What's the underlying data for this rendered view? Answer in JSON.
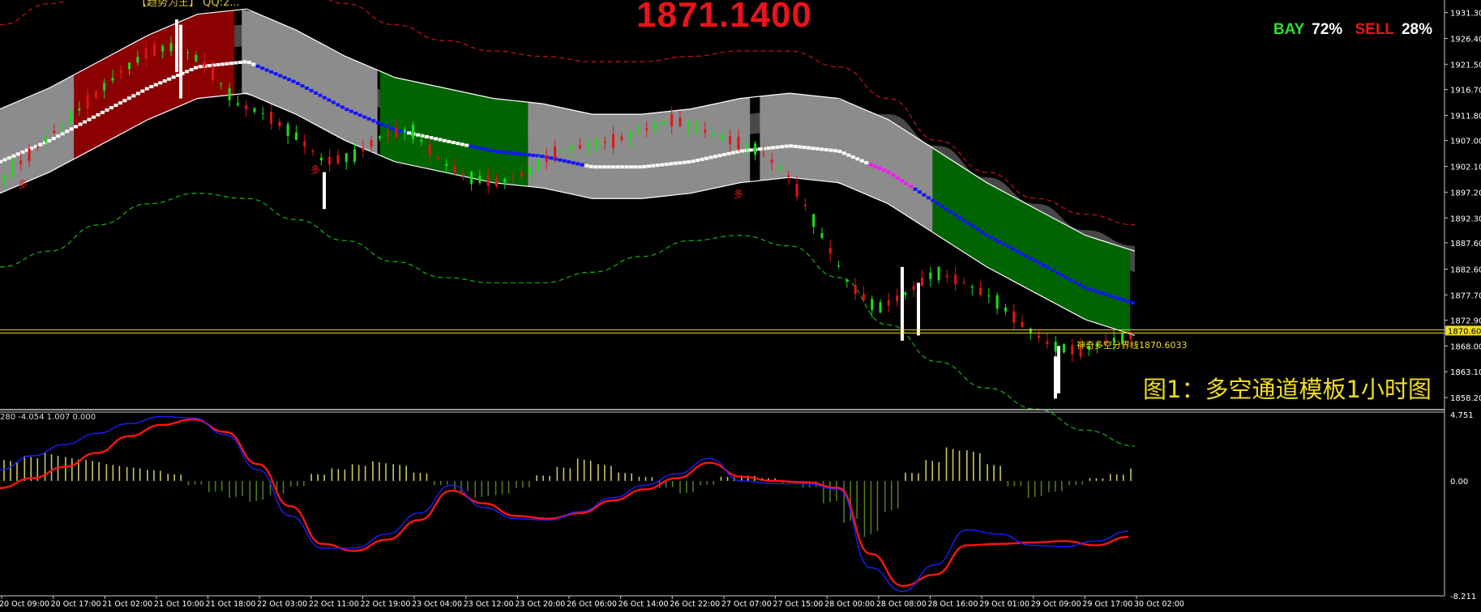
{
  "header": {
    "top_text": "【趋势为王】 QQ:2..."
  },
  "price_display": {
    "current_price": "1871.1400",
    "buy_label": "BAY",
    "buy_pct": "72%",
    "sell_label": "SELL",
    "sell_pct": "28%"
  },
  "annotations": {
    "boundary_label": "神奇多空分界线1870.6033",
    "figure_caption": "图1：多空通道模板1小时图",
    "oscillator_params": "280 -4.054 1.007 0.000",
    "many_marker": "多"
  },
  "colors": {
    "background": "#000000",
    "bull_candle": "#16e016",
    "bear_candle": "#e01414",
    "red_band": "#8b0000",
    "green_band": "#006400",
    "gray_band": "#8c8c8c",
    "dark_gray_band": "#505050",
    "blue_dots": "#1414ff",
    "magenta_dots": "#ff14ff",
    "white_dots": "#ffffff",
    "price_line": "#f0dc1e",
    "osc_red": "#ff1414",
    "osc_blue": "#1e1eff",
    "hist_pos": "#c8c864",
    "hist_neg": "#507a20"
  },
  "chart_data": [
    {
      "type": "candlestick",
      "title": "",
      "ylim": [
        1855.6,
        1933.7
      ],
      "price_axis_ticks": [
        "1931.30",
        "1926.40",
        "1921.50",
        "1916.70",
        "1911.80",
        "1907.00",
        "1902.10",
        "1897.20",
        "1892.30",
        "1887.60",
        "1882.60",
        "1877.70",
        "1872.90",
        "1868.00",
        "1863.10",
        "1858.20"
      ],
      "current_price_tag": "1870.60",
      "boundary_line_value": 1870.6033,
      "time_labels": [
        "20 Oct 09:00",
        "20 Oct 17:00",
        "21 Oct 02:00",
        "21 Oct 10:00",
        "21 Oct 18:00",
        "22 Oct 03:00",
        "22 Oct 11:00",
        "22 Oct 19:00",
        "23 Oct 04:00",
        "23 Oct 12:00",
        "23 Oct 20:00",
        "26 Oct 06:00",
        "26 Oct 14:00",
        "26 Oct 22:00",
        "27 Oct 07:00",
        "27 Oct 15:00",
        "28 Oct 00:00",
        "28 Oct 08:00",
        "28 Oct 16:00",
        "29 Oct 01:00",
        "29 Oct 09:00",
        "29 Oct 17:00",
        "30 Oct 02:00"
      ],
      "channel_mid": [
        1905,
        1909,
        1914,
        1919,
        1923,
        1924,
        1920,
        1915,
        1911,
        1909,
        1907,
        1906,
        1904,
        1904,
        1905,
        1907,
        1908,
        1907,
        1903,
        1897,
        1891,
        1886,
        1881,
        1878
      ],
      "outer_upper": [
        1929,
        1933,
        1936,
        1938,
        1940,
        1940,
        1937,
        1933,
        1929,
        1926,
        1924,
        1923,
        1922,
        1922,
        1923,
        1924,
        1924,
        1921,
        1915,
        1907,
        1901,
        1896,
        1893,
        1891
      ],
      "outer_lower": [
        1883,
        1886,
        1891,
        1895,
        1897,
        1896,
        1892,
        1888,
        1884,
        1881,
        1880,
        1880,
        1882,
        1885,
        1888,
        1889,
        1887,
        1881,
        1872,
        1865,
        1860,
        1856,
        1852,
        1849
      ],
      "candle_close": [
        1900,
        1905,
        1910,
        1915,
        1920,
        1924,
        1925,
        1921,
        1914,
        1912,
        1908,
        1903,
        1904,
        1908,
        1909,
        1903,
        1900,
        1899,
        1901,
        1905,
        1906,
        1907,
        1909,
        1911,
        1909,
        1907,
        1905,
        1900,
        1890,
        1880,
        1875,
        1878,
        1882,
        1880,
        1877,
        1872,
        1868,
        1867,
        1869,
        1870
      ]
    },
    {
      "type": "oscillator",
      "title": "",
      "ylim": [
        -8.211,
        4.751
      ],
      "axis_ticks": [
        "4.751",
        "0.00",
        "-8.211"
      ],
      "histogram": [
        1.5,
        1.8,
        2.0,
        1.7,
        1.5,
        1.2,
        1.0,
        0.8,
        0.5,
        -0.3,
        -0.8,
        -1.2,
        -1.5,
        -1.0,
        -0.4,
        0.5,
        0.9,
        1.2,
        1.4,
        1.2,
        0.6,
        -0.3,
        -0.8,
        -1.2,
        -1.0,
        -0.5,
        0.4,
        1.0,
        1.6,
        1.2,
        0.6,
        0.3,
        -0.5,
        -0.9,
        -0.3,
        0.3,
        0.4,
        0.2,
        -0.2,
        -0.5,
        -1.6,
        -3.0,
        -4.0,
        -2.2,
        0.6,
        1.5,
        2.4,
        2.2,
        1.2,
        -0.4,
        -1.2,
        -0.8,
        -0.3,
        0.2,
        0.5,
        0.9
      ],
      "series": [
        {
          "name": "",
          "color": "#ff1414",
          "values": [
            -0.5,
            0.2,
            1.0,
            2.0,
            3.2,
            4.0,
            4.4,
            3.5,
            1.2,
            -1.8,
            -4.5,
            -5.0,
            -4.2,
            -2.8,
            -0.7,
            -1.6,
            -2.5,
            -2.7,
            -2.3,
            -1.4,
            -0.6,
            0.2,
            1.3,
            0.3,
            0.0,
            -0.1,
            -0.5,
            -5.2,
            -7.5,
            -6.7,
            -4.6,
            -4.5,
            -4.4,
            -4.3,
            -4.6,
            -4.0
          ]
        },
        {
          "name": "",
          "color": "#1e1eff",
          "values": [
            0.8,
            1.8,
            2.6,
            3.4,
            4.1,
            4.6,
            4.5,
            3.3,
            0.8,
            -2.5,
            -4.8,
            -4.8,
            -3.8,
            -2.3,
            -0.3,
            -1.9,
            -2.7,
            -2.8,
            -2.2,
            -1.2,
            -0.3,
            0.5,
            1.6,
            0.0,
            -0.2,
            -0.2,
            -0.6,
            -6.2,
            -7.9,
            -6.0,
            -3.5,
            -3.8,
            -4.6,
            -4.7,
            -4.3,
            -3.6
          ]
        }
      ]
    }
  ]
}
